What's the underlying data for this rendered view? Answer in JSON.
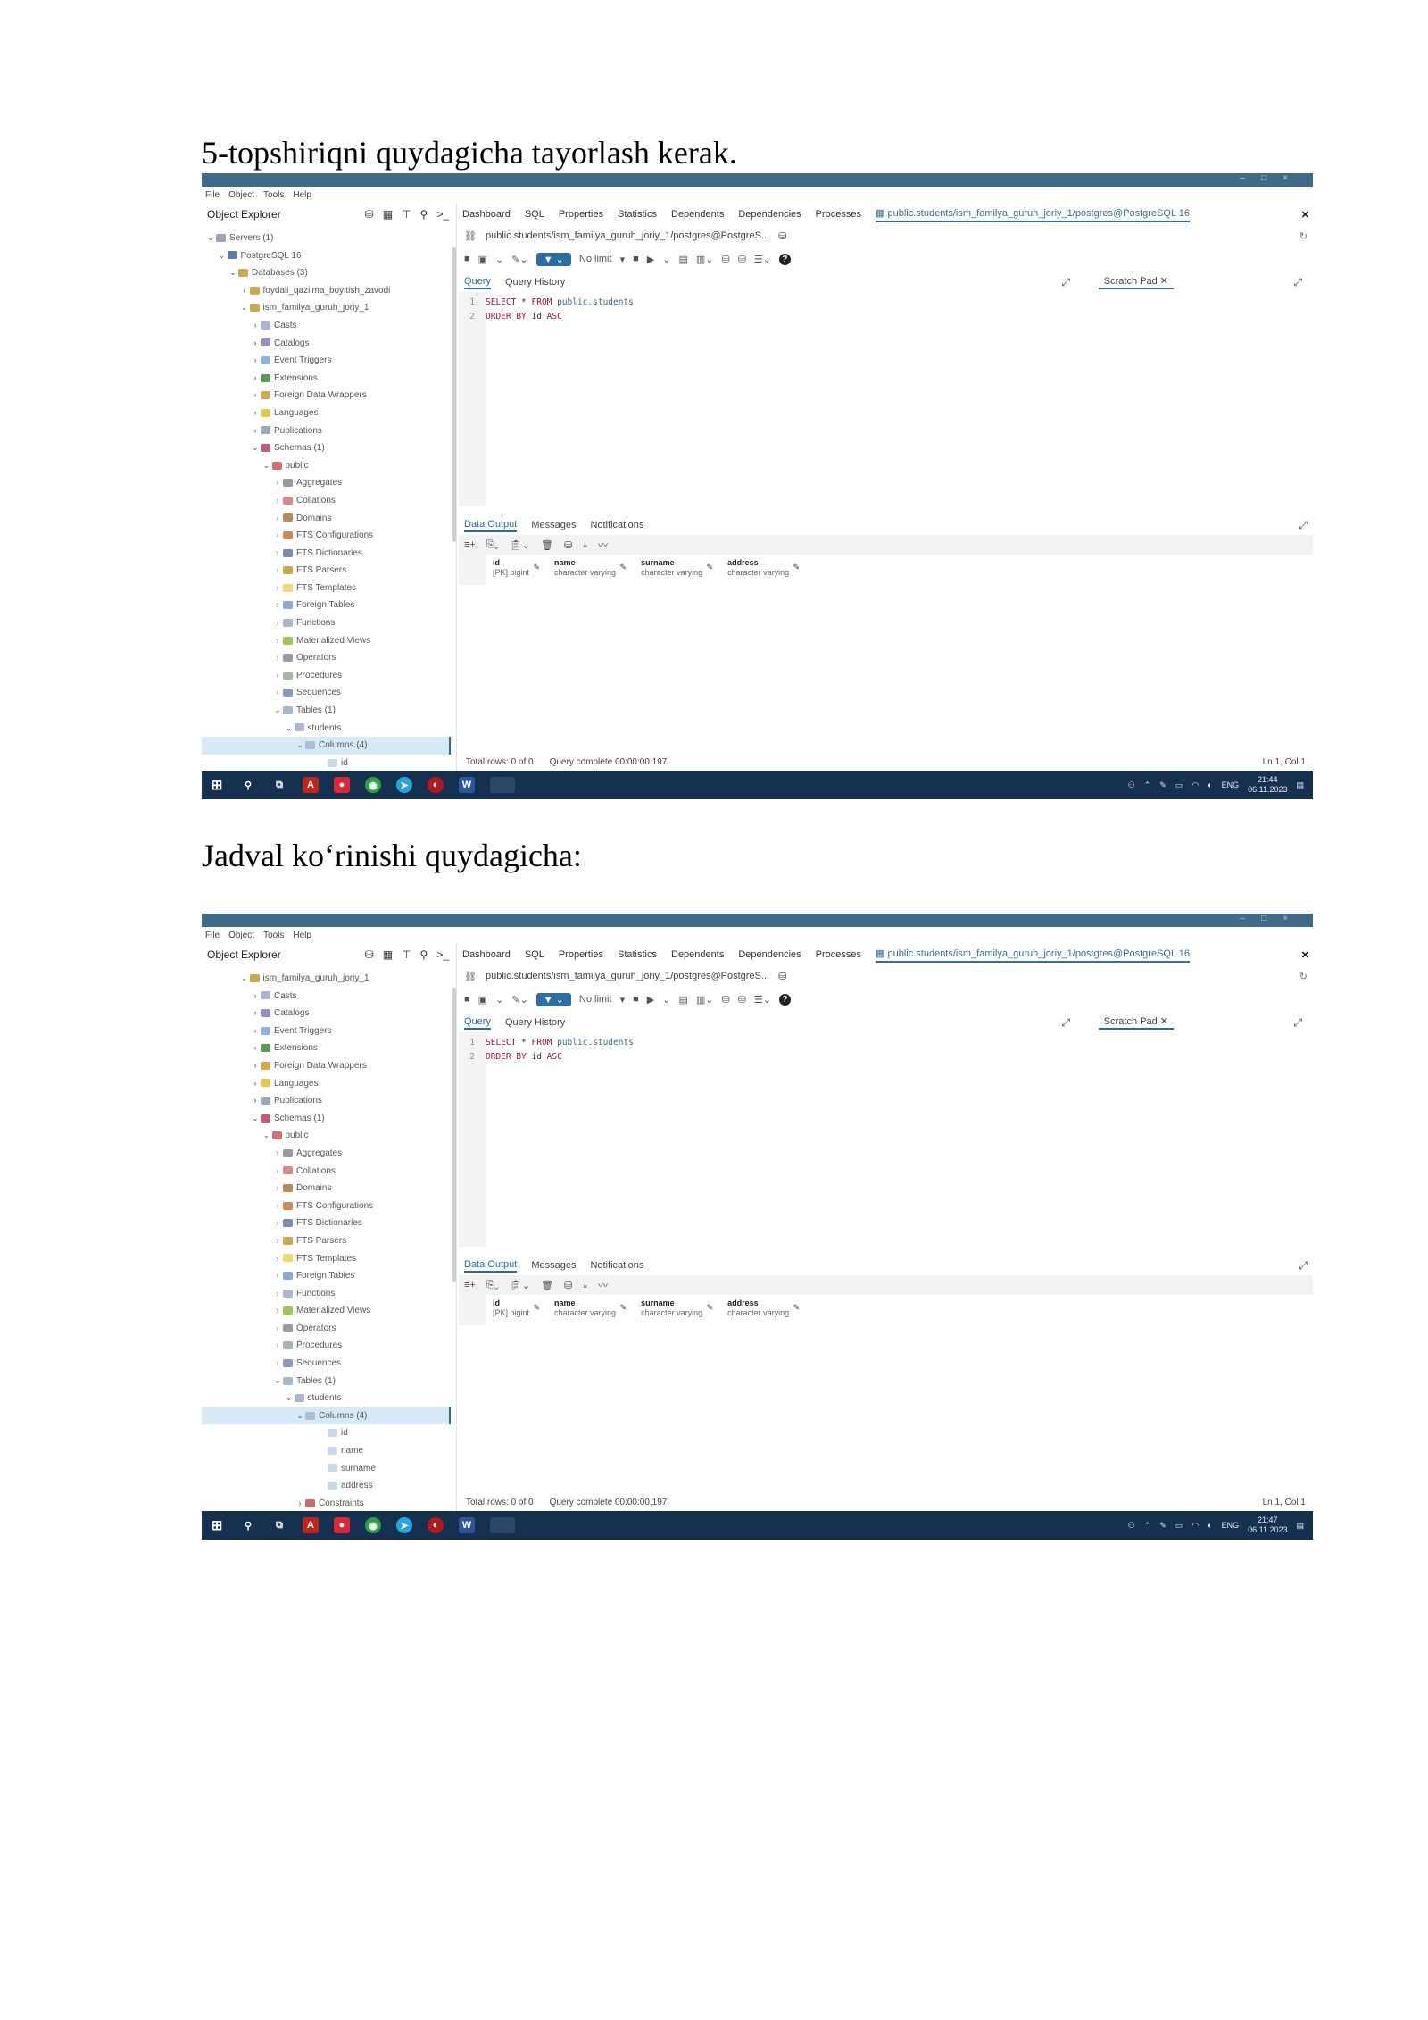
{
  "headings": {
    "first": "5-topshiriqni  quydagicha tayorlash kerak.",
    "second": "Jadval ko‘rinishi quydagicha:"
  },
  "app": {
    "menu": [
      "File",
      "Object",
      "Tools",
      "Help"
    ],
    "explorer_title": "Object Explorer",
    "tabs": [
      "Dashboard",
      "SQL",
      "Properties",
      "Statistics",
      "Dependents",
      "Dependencies",
      "Processes"
    ],
    "active_tab": "public.students/ism_familya_guruh_joriy_1/postgres@PostgreSQL 16",
    "query_path": "public.students/ism_familya_guruh_joriy_1/postgres@PostgreS...",
    "row_limit": "No limit",
    "editor_tabs": [
      "Query",
      "Query History"
    ],
    "scratch_pad": "Scratch Pad",
    "sql_lines": [
      {
        "n": "1",
        "kw1": "SELECT",
        "mid": " * ",
        "kw2": "FROM",
        "tbl": " public.students"
      },
      {
        "n": "2",
        "kw1": "ORDER BY",
        "mid": " id ",
        "kw2": "ASC",
        "tbl": ""
      }
    ],
    "output_tabs": [
      "Data Output",
      "Messages",
      "Notifications"
    ],
    "columns": [
      {
        "name": "id",
        "type": "[PK] bigint"
      },
      {
        "name": "name",
        "type": "character varying"
      },
      {
        "name": "surname",
        "type": "character varying"
      },
      {
        "name": "address",
        "type": "character varying"
      }
    ],
    "status_rows": "Total rows: 0 of 0",
    "status_query": "Query complete 00:00:00.197",
    "status_pos": "Ln 1, Col 1"
  },
  "screenshots": [
    {
      "clock_time": "21:44",
      "clock_date": "06.11.2023",
      "tree": [
        {
          "label": "Servers (1)",
          "indent": 0,
          "chev": "v",
          "icon": "#9aa5b1"
        },
        {
          "label": "PostgreSQL 16",
          "indent": 1,
          "chev": "v",
          "icon": "#5b7fa6"
        },
        {
          "label": "Databases (3)",
          "indent": 2,
          "chev": "v",
          "icon": "#c8a850"
        },
        {
          "label": "foydali_qazilma_boyitish_zavodi",
          "indent": 3,
          "chev": ">",
          "icon": "#c8a850"
        },
        {
          "label": "ism_familya_guruh_joriy_1",
          "indent": 3,
          "chev": "v",
          "icon": "#c8a850"
        },
        {
          "label": "Casts",
          "indent": 4,
          "chev": ">",
          "icon": "#a9b6d4"
        },
        {
          "label": "Catalogs",
          "indent": 4,
          "chev": ">",
          "icon": "#9c8ec7"
        },
        {
          "label": "Event Triggers",
          "indent": 4,
          "chev": ">",
          "icon": "#8fb3d9"
        },
        {
          "label": "Extensions",
          "indent": 4,
          "chev": ">",
          "icon": "#5a9a5a"
        },
        {
          "label": "Foreign Data Wrappers",
          "indent": 4,
          "chev": ">",
          "icon": "#d4a84e"
        },
        {
          "label": "Languages",
          "indent": 4,
          "chev": ">",
          "icon": "#e3c84f"
        },
        {
          "label": "Publications",
          "indent": 4,
          "chev": ">",
          "icon": "#9aa8b8"
        },
        {
          "label": "Schemas (1)",
          "indent": 4,
          "chev": "v",
          "icon": "#c25a7a"
        },
        {
          "label": "public",
          "indent": 5,
          "chev": "v",
          "icon": "#d2707a"
        },
        {
          "label": "Aggregates",
          "indent": 6,
          "chev": ">",
          "icon": "#9a9a9a"
        },
        {
          "label": "Collations",
          "indent": 6,
          "chev": ">",
          "icon": "#d48a8a"
        },
        {
          "label": "Domains",
          "indent": 6,
          "chev": ">",
          "icon": "#b88a5a"
        },
        {
          "label": "FTS Configurations",
          "indent": 6,
          "chev": ">",
          "icon": "#c98a5a"
        },
        {
          "label": "FTS Dictionaries",
          "indent": 6,
          "chev": ">",
          "icon": "#7a8aa8"
        },
        {
          "label": "FTS Parsers",
          "indent": 6,
          "chev": ">",
          "icon": "#c8a850"
        },
        {
          "label": "FTS Templates",
          "indent": 6,
          "chev": ">",
          "icon": "#f0d878"
        },
        {
          "label": "Foreign Tables",
          "indent": 6,
          "chev": ">",
          "icon": "#8fa8d4"
        },
        {
          "label": "Functions",
          "indent": 6,
          "chev": ">",
          "icon": "#a8b8c8"
        },
        {
          "label": "Materialized Views",
          "indent": 6,
          "chev": ">",
          "icon": "#9ac85a"
        },
        {
          "label": "Operators",
          "indent": 6,
          "chev": ">",
          "icon": "#9a9aa8"
        },
        {
          "label": "Procedures",
          "indent": 6,
          "chev": ">",
          "icon": "#a8b8a8"
        },
        {
          "label": "Sequences",
          "indent": 6,
          "chev": ">",
          "icon": "#8a9ab8"
        },
        {
          "label": "Tables (1)",
          "indent": 6,
          "chev": "v",
          "icon": "#a8b8c8"
        },
        {
          "label": "students",
          "indent": 7,
          "chev": "v",
          "icon": "#a8b8c8"
        },
        {
          "label": "Columns (4)",
          "indent": 8,
          "chev": "v",
          "icon": "#a8c0d8",
          "selected": true
        },
        {
          "label": "id",
          "indent": 10,
          "chev": "",
          "icon": "#c8d8e8"
        }
      ]
    },
    {
      "clock_time": "21:47",
      "clock_date": "06.11.2023",
      "tree": [
        {
          "label": "ism_familya_guruh_joriy_1",
          "indent": 3,
          "chev": "v",
          "icon": "#c8a850"
        },
        {
          "label": "Casts",
          "indent": 4,
          "chev": ">",
          "icon": "#a9b6d4"
        },
        {
          "label": "Catalogs",
          "indent": 4,
          "chev": ">",
          "icon": "#9c8ec7"
        },
        {
          "label": "Event Triggers",
          "indent": 4,
          "chev": ">",
          "icon": "#8fb3d9"
        },
        {
          "label": "Extensions",
          "indent": 4,
          "chev": ">",
          "icon": "#5a9a5a"
        },
        {
          "label": "Foreign Data Wrappers",
          "indent": 4,
          "chev": ">",
          "icon": "#d4a84e"
        },
        {
          "label": "Languages",
          "indent": 4,
          "chev": ">",
          "icon": "#e3c84f"
        },
        {
          "label": "Publications",
          "indent": 4,
          "chev": ">",
          "icon": "#9aa8b8"
        },
        {
          "label": "Schemas (1)",
          "indent": 4,
          "chev": "v",
          "icon": "#c25a7a"
        },
        {
          "label": "public",
          "indent": 5,
          "chev": "v",
          "icon": "#d2707a"
        },
        {
          "label": "Aggregates",
          "indent": 6,
          "chev": ">",
          "icon": "#9a9a9a"
        },
        {
          "label": "Collations",
          "indent": 6,
          "chev": ">",
          "icon": "#d48a8a"
        },
        {
          "label": "Domains",
          "indent": 6,
          "chev": ">",
          "icon": "#b88a5a"
        },
        {
          "label": "FTS Configurations",
          "indent": 6,
          "chev": ">",
          "icon": "#c98a5a"
        },
        {
          "label": "FTS Dictionaries",
          "indent": 6,
          "chev": ">",
          "icon": "#7a8aa8"
        },
        {
          "label": "FTS Parsers",
          "indent": 6,
          "chev": ">",
          "icon": "#c8a850"
        },
        {
          "label": "FTS Templates",
          "indent": 6,
          "chev": ">",
          "icon": "#f0d878"
        },
        {
          "label": "Foreign Tables",
          "indent": 6,
          "chev": ">",
          "icon": "#8fa8d4"
        },
        {
          "label": "Functions",
          "indent": 6,
          "chev": ">",
          "icon": "#a8b8c8"
        },
        {
          "label": "Materialized Views",
          "indent": 6,
          "chev": ">",
          "icon": "#9ac85a"
        },
        {
          "label": "Operators",
          "indent": 6,
          "chev": ">",
          "icon": "#9a9aa8"
        },
        {
          "label": "Procedures",
          "indent": 6,
          "chev": ">",
          "icon": "#a8b8a8"
        },
        {
          "label": "Sequences",
          "indent": 6,
          "chev": ">",
          "icon": "#8a9ab8"
        },
        {
          "label": "Tables (1)",
          "indent": 6,
          "chev": "v",
          "icon": "#a8b8c8"
        },
        {
          "label": "students",
          "indent": 7,
          "chev": "v",
          "icon": "#a8b8c8"
        },
        {
          "label": "Columns (4)",
          "indent": 8,
          "chev": "v",
          "icon": "#a8c0d8",
          "selected": true
        },
        {
          "label": "id",
          "indent": 10,
          "chev": "",
          "icon": "#c8d8e8"
        },
        {
          "label": "name",
          "indent": 10,
          "chev": "",
          "icon": "#c8d8e8"
        },
        {
          "label": "surname",
          "indent": 10,
          "chev": "",
          "icon": "#c8d8e8"
        },
        {
          "label": "address",
          "indent": 10,
          "chev": "",
          "icon": "#c8d8e8"
        },
        {
          "label": "Constraints",
          "indent": 8,
          "chev": ">",
          "icon": "#c86a6a"
        }
      ]
    }
  ]
}
